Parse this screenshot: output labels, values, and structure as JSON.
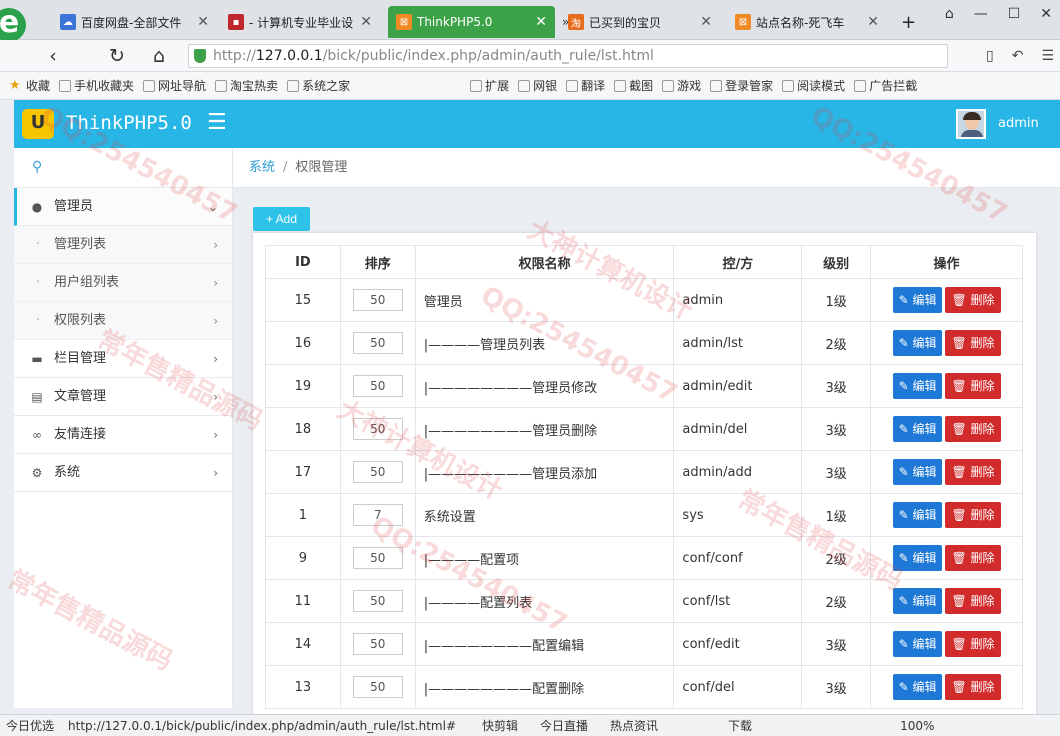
{
  "browser": {
    "tabs": [
      {
        "label": "百度网盘-全部文件",
        "color": "#3b74d6",
        "active": false
      },
      {
        "label": "- 计算机专业毕业设",
        "color": "#c0272d",
        "active": false
      },
      {
        "label": "ThinkPHP5.0",
        "color": "#ef8a24",
        "active": true
      },
      {
        "label": "已买到的宝贝",
        "color": "#e86b1c",
        "active": false
      },
      {
        "label": "站点名称-死飞车",
        "color": "#ef8a24",
        "active": false
      }
    ],
    "tab_overflow": "»",
    "new_tab": "+",
    "url_prefix": "http://",
    "url_host": "127.0.0.1",
    "url_path": "/bick/public/index.php/admin/auth_rule/lst.html",
    "bookmarks": [
      "收藏",
      "手机收藏夹",
      "网址导航",
      "淘宝热卖",
      "系统之家",
      "扩展",
      "网银",
      "翻译",
      "截图",
      "游戏",
      "登录管家",
      "阅读模式",
      "广告拦截"
    ]
  },
  "app": {
    "brand_logo": "U",
    "brand": "ThinkPHP5.0",
    "user": "admin"
  },
  "sidebar": {
    "items": [
      {
        "label": "管理员",
        "icon": "user-icon",
        "open": true,
        "children": [
          "管理列表",
          "用户组列表",
          "权限列表"
        ]
      },
      {
        "label": "栏目管理",
        "icon": "folder-icon"
      },
      {
        "label": "文章管理",
        "icon": "file-icon"
      },
      {
        "label": "友情连接",
        "icon": "link-icon"
      },
      {
        "label": "系统",
        "icon": "gear-icon"
      }
    ]
  },
  "breadcrumb": {
    "root": "系统",
    "separator": "/",
    "current": "权限管理"
  },
  "add_button": "+ Add",
  "table": {
    "headers": [
      "ID",
      "排序",
      "权限名称",
      "控/方",
      "级别",
      "操作"
    ],
    "edit_label": "编辑",
    "delete_label": "删除",
    "rows": [
      {
        "id": "15",
        "sort": "50",
        "name": "管理员",
        "ctrl": "admin",
        "level": "1级"
      },
      {
        "id": "16",
        "sort": "50",
        "name": "|————管理员列表",
        "ctrl": "admin/lst",
        "level": "2级"
      },
      {
        "id": "19",
        "sort": "50",
        "name": "|————————管理员修改",
        "ctrl": "admin/edit",
        "level": "3级"
      },
      {
        "id": "18",
        "sort": "50",
        "name": "|————————管理员删除",
        "ctrl": "admin/del",
        "level": "3级"
      },
      {
        "id": "17",
        "sort": "50",
        "name": "|————————管理员添加",
        "ctrl": "admin/add",
        "level": "3级"
      },
      {
        "id": "1",
        "sort": "7",
        "name": "系统设置",
        "ctrl": "sys",
        "level": "1级"
      },
      {
        "id": "9",
        "sort": "50",
        "name": "|————配置项",
        "ctrl": "conf/conf",
        "level": "2级"
      },
      {
        "id": "11",
        "sort": "50",
        "name": "|————配置列表",
        "ctrl": "conf/lst",
        "level": "2级"
      },
      {
        "id": "14",
        "sort": "50",
        "name": "|————————配置编辑",
        "ctrl": "conf/edit",
        "level": "3级"
      },
      {
        "id": "13",
        "sort": "50",
        "name": "|————————配置删除",
        "ctrl": "conf/del",
        "level": "3级"
      }
    ]
  },
  "statusbar": {
    "left": "今日优选",
    "url": "http://127.0.0.1/bick/public/index.php/admin/auth_rule/lst.html#",
    "items": [
      "快剪辑",
      "今日直播",
      "热点资讯",
      "下载"
    ],
    "zoom": "100%"
  },
  "watermark": [
    "QQ:254540457",
    "大神计算机设计",
    "常年售精品源码"
  ]
}
